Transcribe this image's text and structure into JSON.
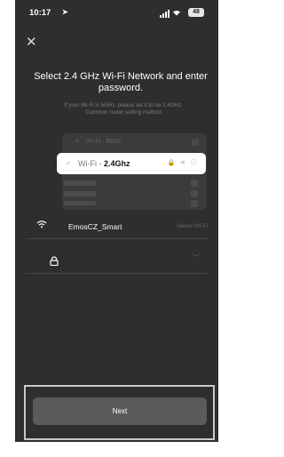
{
  "status_bar": {
    "time": "10:17",
    "battery": "48"
  },
  "header": {
    "title": "Select 2.4 GHz Wi-Fi Network and enter password.",
    "hint_line1": "If your Wi-Fi is 5GHz, please set it to be 2.4GHz.",
    "hint_line2": "Common router setting method"
  },
  "illustration": {
    "row_5g": {
      "prefix": "Wi-Fi - ",
      "band": "5Ghz"
    },
    "row_selected": {
      "prefix": "Wi-Fi - ",
      "band": "2.4Ghz"
    }
  },
  "form": {
    "network_name": "EmosCZ_Smart",
    "select_wifi_label": "Select Wi-Fi",
    "password_value": ""
  },
  "footer": {
    "next_label": "Next"
  },
  "colors": {
    "background": "#2e2e30",
    "button": "#5b5b5d",
    "selected_card": "#ffffff"
  },
  "icons": [
    "close-icon",
    "wifi-icon",
    "lock-icon",
    "chevron-down-icon",
    "check-icon",
    "info-icon"
  ]
}
